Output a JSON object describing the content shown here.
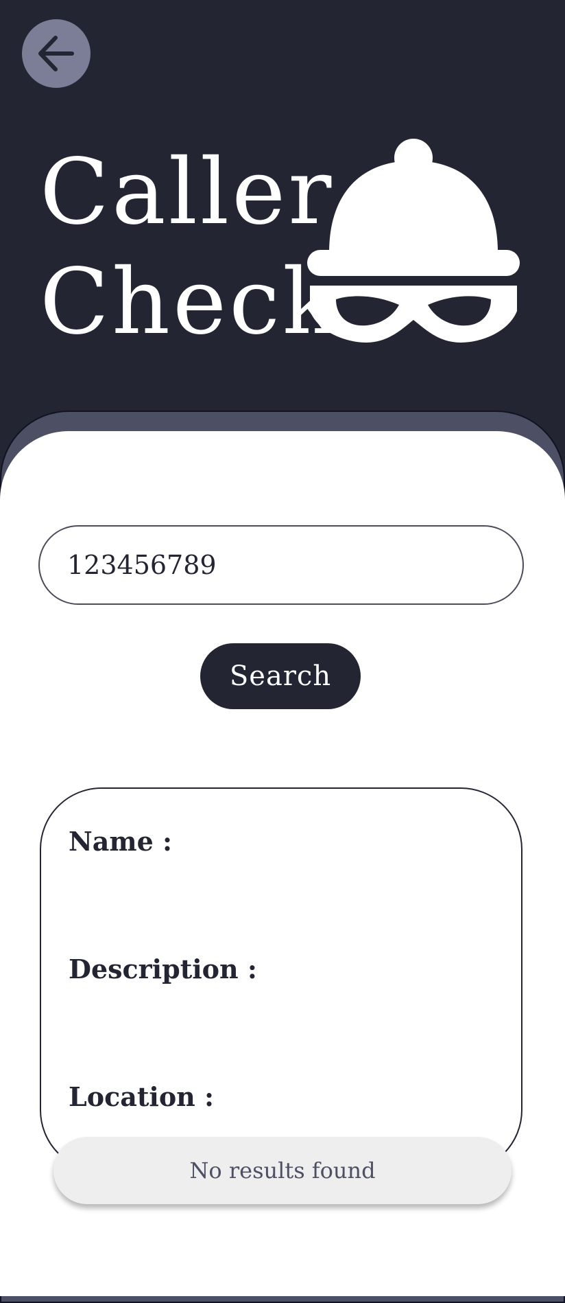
{
  "app": {
    "title_line1": "Caller",
    "title_line2": "Check",
    "logo_icon": "burglar-beanie-mask-icon",
    "back_icon": "arrow-left-icon"
  },
  "search": {
    "value": "123456789",
    "button_label": "Search"
  },
  "result": {
    "name_label": "Name :",
    "description_label": "Description :",
    "location_label": "Location :"
  },
  "toast": {
    "message": "No results found"
  },
  "colors": {
    "primary_dark": "#232533",
    "accent_gray": "#7b7e96",
    "sheet_shadow": "#4d5064",
    "toast_bg": "#eeeeee"
  }
}
